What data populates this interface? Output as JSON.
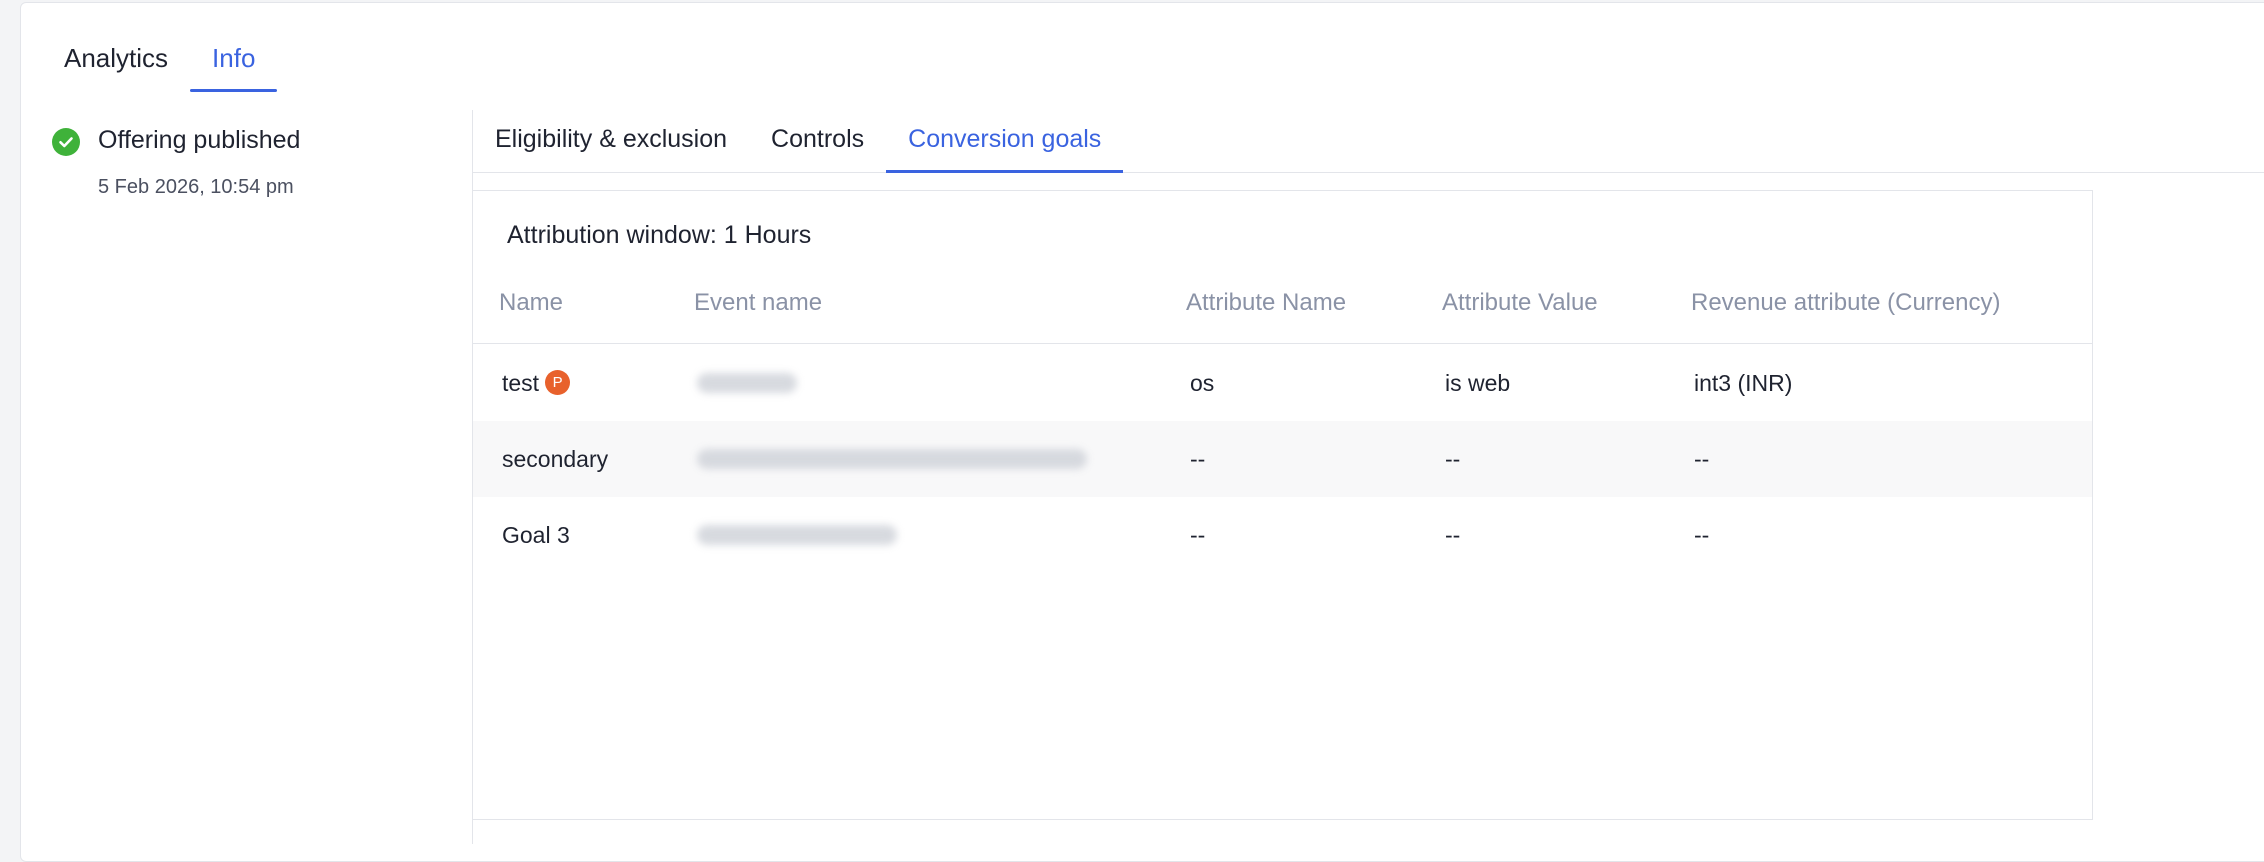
{
  "top_tabs": [
    {
      "label": "Analytics",
      "active": false
    },
    {
      "label": "Info",
      "active": true
    }
  ],
  "status": {
    "title": "Offering published",
    "timestamp": "5 Feb 2026, 10:54 pm",
    "icon": "check-circle-icon"
  },
  "sub_tabs": [
    {
      "label": "Eligibility & exclusion",
      "active": false
    },
    {
      "label": "Controls",
      "active": false
    },
    {
      "label": "Conversion goals",
      "active": true
    }
  ],
  "conversion": {
    "attribution_window": "Attribution window: 1 Hours",
    "columns": [
      "Name",
      "Event name",
      "Attribute Name",
      "Attribute Value",
      "Revenue attribute (Currency)"
    ],
    "rows": [
      {
        "name": "test",
        "badge": "P",
        "attr_name": "os",
        "attr_value": "is web",
        "revenue": "int3 (INR)"
      },
      {
        "name": "secondary",
        "badge": "",
        "attr_name": "--",
        "attr_value": "--",
        "revenue": "--"
      },
      {
        "name": "Goal 3",
        "badge": "",
        "attr_name": "--",
        "attr_value": "--",
        "revenue": "--"
      }
    ]
  },
  "colors": {
    "accent": "#3a63e0",
    "success": "#3fb23a",
    "badge": "#e8612c",
    "muted": "#8a92a6"
  }
}
